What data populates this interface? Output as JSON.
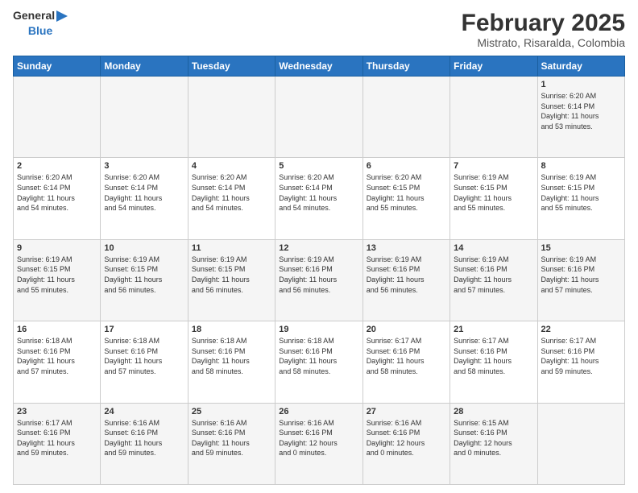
{
  "header": {
    "logo_general": "General",
    "logo_blue": "Blue",
    "month": "February 2025",
    "location": "Mistrato, Risaralda, Colombia"
  },
  "weekdays": [
    "Sunday",
    "Monday",
    "Tuesday",
    "Wednesday",
    "Thursday",
    "Friday",
    "Saturday"
  ],
  "weeks": [
    [
      {
        "day": "",
        "info": ""
      },
      {
        "day": "",
        "info": ""
      },
      {
        "day": "",
        "info": ""
      },
      {
        "day": "",
        "info": ""
      },
      {
        "day": "",
        "info": ""
      },
      {
        "day": "",
        "info": ""
      },
      {
        "day": "1",
        "info": "Sunrise: 6:20 AM\nSunset: 6:14 PM\nDaylight: 11 hours\nand 53 minutes."
      }
    ],
    [
      {
        "day": "2",
        "info": "Sunrise: 6:20 AM\nSunset: 6:14 PM\nDaylight: 11 hours\nand 54 minutes."
      },
      {
        "day": "3",
        "info": "Sunrise: 6:20 AM\nSunset: 6:14 PM\nDaylight: 11 hours\nand 54 minutes."
      },
      {
        "day": "4",
        "info": "Sunrise: 6:20 AM\nSunset: 6:14 PM\nDaylight: 11 hours\nand 54 minutes."
      },
      {
        "day": "5",
        "info": "Sunrise: 6:20 AM\nSunset: 6:14 PM\nDaylight: 11 hours\nand 54 minutes."
      },
      {
        "day": "6",
        "info": "Sunrise: 6:20 AM\nSunset: 6:15 PM\nDaylight: 11 hours\nand 55 minutes."
      },
      {
        "day": "7",
        "info": "Sunrise: 6:19 AM\nSunset: 6:15 PM\nDaylight: 11 hours\nand 55 minutes."
      },
      {
        "day": "8",
        "info": "Sunrise: 6:19 AM\nSunset: 6:15 PM\nDaylight: 11 hours\nand 55 minutes."
      }
    ],
    [
      {
        "day": "9",
        "info": "Sunrise: 6:19 AM\nSunset: 6:15 PM\nDaylight: 11 hours\nand 55 minutes."
      },
      {
        "day": "10",
        "info": "Sunrise: 6:19 AM\nSunset: 6:15 PM\nDaylight: 11 hours\nand 56 minutes."
      },
      {
        "day": "11",
        "info": "Sunrise: 6:19 AM\nSunset: 6:15 PM\nDaylight: 11 hours\nand 56 minutes."
      },
      {
        "day": "12",
        "info": "Sunrise: 6:19 AM\nSunset: 6:16 PM\nDaylight: 11 hours\nand 56 minutes."
      },
      {
        "day": "13",
        "info": "Sunrise: 6:19 AM\nSunset: 6:16 PM\nDaylight: 11 hours\nand 56 minutes."
      },
      {
        "day": "14",
        "info": "Sunrise: 6:19 AM\nSunset: 6:16 PM\nDaylight: 11 hours\nand 57 minutes."
      },
      {
        "day": "15",
        "info": "Sunrise: 6:19 AM\nSunset: 6:16 PM\nDaylight: 11 hours\nand 57 minutes."
      }
    ],
    [
      {
        "day": "16",
        "info": "Sunrise: 6:18 AM\nSunset: 6:16 PM\nDaylight: 11 hours\nand 57 minutes."
      },
      {
        "day": "17",
        "info": "Sunrise: 6:18 AM\nSunset: 6:16 PM\nDaylight: 11 hours\nand 57 minutes."
      },
      {
        "day": "18",
        "info": "Sunrise: 6:18 AM\nSunset: 6:16 PM\nDaylight: 11 hours\nand 58 minutes."
      },
      {
        "day": "19",
        "info": "Sunrise: 6:18 AM\nSunset: 6:16 PM\nDaylight: 11 hours\nand 58 minutes."
      },
      {
        "day": "20",
        "info": "Sunrise: 6:17 AM\nSunset: 6:16 PM\nDaylight: 11 hours\nand 58 minutes."
      },
      {
        "day": "21",
        "info": "Sunrise: 6:17 AM\nSunset: 6:16 PM\nDaylight: 11 hours\nand 58 minutes."
      },
      {
        "day": "22",
        "info": "Sunrise: 6:17 AM\nSunset: 6:16 PM\nDaylight: 11 hours\nand 59 minutes."
      }
    ],
    [
      {
        "day": "23",
        "info": "Sunrise: 6:17 AM\nSunset: 6:16 PM\nDaylight: 11 hours\nand 59 minutes."
      },
      {
        "day": "24",
        "info": "Sunrise: 6:16 AM\nSunset: 6:16 PM\nDaylight: 11 hours\nand 59 minutes."
      },
      {
        "day": "25",
        "info": "Sunrise: 6:16 AM\nSunset: 6:16 PM\nDaylight: 11 hours\nand 59 minutes."
      },
      {
        "day": "26",
        "info": "Sunrise: 6:16 AM\nSunset: 6:16 PM\nDaylight: 12 hours\nand 0 minutes."
      },
      {
        "day": "27",
        "info": "Sunrise: 6:16 AM\nSunset: 6:16 PM\nDaylight: 12 hours\nand 0 minutes."
      },
      {
        "day": "28",
        "info": "Sunrise: 6:15 AM\nSunset: 6:16 PM\nDaylight: 12 hours\nand 0 minutes."
      },
      {
        "day": "",
        "info": ""
      }
    ]
  ]
}
